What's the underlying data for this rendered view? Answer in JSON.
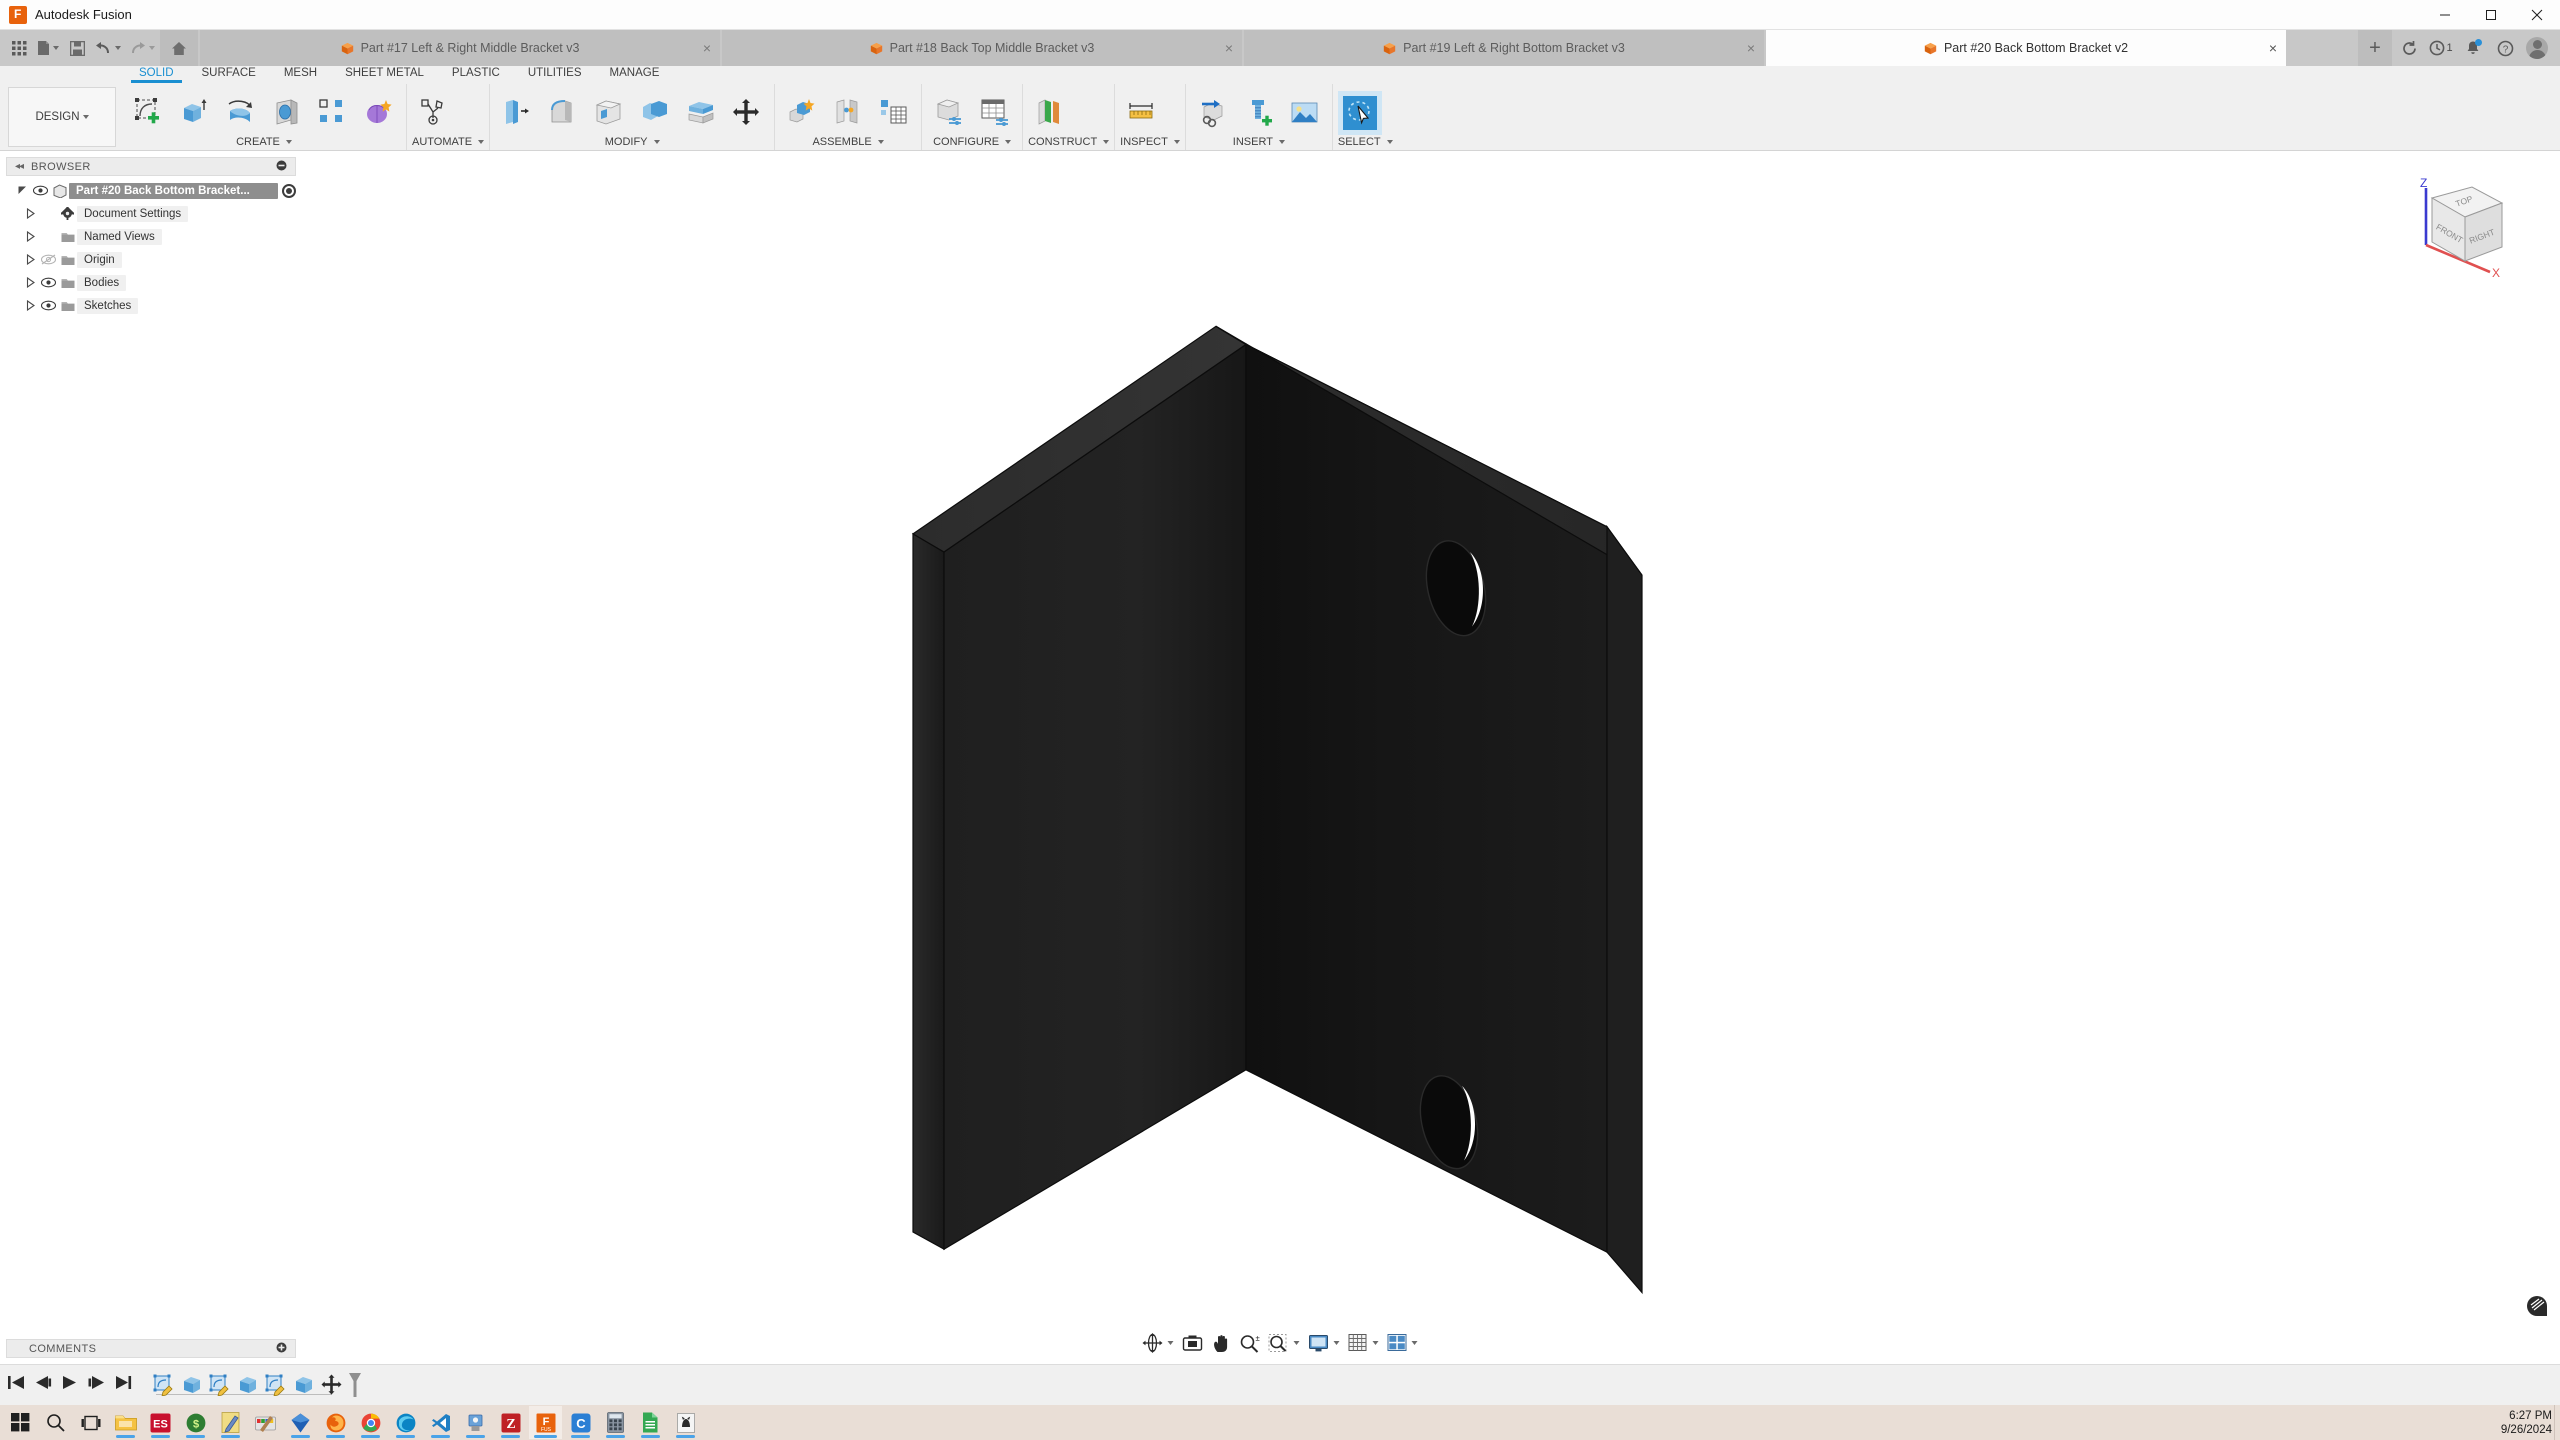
{
  "window": {
    "app_title": "Autodesk Fusion",
    "app_icon": "fusion-logo-icon",
    "minimize_label": "Minimize",
    "maximize_label": "Maximize",
    "close_label": "Close"
  },
  "quick_access": {
    "items": [
      {
        "name": "app-grid-icon",
        "label": "Show Data Panel"
      },
      {
        "name": "new-file-icon",
        "label": "File",
        "has_dropdown": true
      },
      {
        "name": "save-icon",
        "label": "Save"
      },
      {
        "name": "undo-icon",
        "label": "Undo",
        "has_dropdown": true
      },
      {
        "name": "redo-icon",
        "label": "Redo",
        "has_dropdown": true,
        "disabled": true
      },
      {
        "name": "home-icon",
        "label": "Home"
      }
    ]
  },
  "document_tabs": [
    {
      "label": "Part #17 Left & Right Middle Bracket v3",
      "active": false,
      "close": "×"
    },
    {
      "label": "Part #18 Back Top Middle Bracket v3",
      "active": false,
      "close": "×"
    },
    {
      "label": "Part #19 Left & Right Bottom Bracket v3",
      "active": false,
      "close": "×"
    },
    {
      "label": "Part #20 Back Bottom Bracket v2",
      "active": true,
      "close": "×"
    }
  ],
  "appbar_right": {
    "new_tab": "+",
    "items": [
      {
        "name": "refresh-icon",
        "label": "Refresh"
      },
      {
        "name": "job-status-icon",
        "label": "Job Status",
        "count": "1"
      },
      {
        "name": "notifications-bell-icon",
        "label": "Notifications",
        "badge": true
      },
      {
        "name": "help-icon",
        "label": "Help"
      },
      {
        "name": "account-avatar",
        "label": "Account"
      }
    ]
  },
  "ribbon": {
    "workspace_label": "DESIGN",
    "tabs": [
      {
        "label": "SOLID",
        "active": true
      },
      {
        "label": "SURFACE",
        "active": false
      },
      {
        "label": "MESH",
        "active": false
      },
      {
        "label": "SHEET METAL",
        "active": false
      },
      {
        "label": "PLASTIC",
        "active": false
      },
      {
        "label": "UTILITIES",
        "active": false
      },
      {
        "label": "MANAGE",
        "active": false
      }
    ],
    "panels": [
      {
        "label": "CREATE",
        "dropdown": true,
        "commands": [
          {
            "name": "create-sketch-icon",
            "label": "Create Sketch"
          },
          {
            "name": "extrude-icon",
            "label": "Extrude"
          },
          {
            "name": "revolve-icon",
            "label": "Revolve"
          },
          {
            "name": "sweep-icon",
            "label": "Sweep"
          },
          {
            "name": "pattern-icon",
            "label": "Pattern"
          },
          {
            "name": "form-icon",
            "label": "Create Form"
          }
        ]
      },
      {
        "label": "AUTOMATE",
        "dropdown": true,
        "commands": [
          {
            "name": "automate-generative-icon",
            "label": "Automate"
          }
        ]
      },
      {
        "label": "MODIFY",
        "dropdown": true,
        "commands": [
          {
            "name": "press-pull-icon",
            "label": "Press Pull"
          },
          {
            "name": "fillet-icon",
            "label": "Fillet"
          },
          {
            "name": "shell-icon",
            "label": "Shell"
          },
          {
            "name": "combine-icon",
            "label": "Combine"
          },
          {
            "name": "split-body-icon",
            "label": "Split Body"
          },
          {
            "name": "move-copy-icon",
            "label": "Move/Copy"
          }
        ]
      },
      {
        "label": "ASSEMBLE",
        "dropdown": true,
        "commands": [
          {
            "name": "new-component-icon",
            "label": "New Component"
          },
          {
            "name": "joint-icon",
            "label": "Joint"
          },
          {
            "name": "bill-of-materials-icon",
            "label": "Bill of Materials"
          }
        ]
      },
      {
        "label": "CONFIGURE",
        "dropdown": true,
        "commands": [
          {
            "name": "configuration-icon",
            "label": "Create Configuration"
          },
          {
            "name": "configuration-table-icon",
            "label": "Configuration Table"
          }
        ]
      },
      {
        "label": "CONSTRUCT",
        "dropdown": true,
        "commands": [
          {
            "name": "offset-plane-icon",
            "label": "Offset Plane"
          }
        ]
      },
      {
        "label": "INSPECT",
        "dropdown": true,
        "commands": [
          {
            "name": "measure-icon",
            "label": "Measure"
          }
        ]
      },
      {
        "label": "INSERT",
        "dropdown": true,
        "commands": [
          {
            "name": "insert-derive-icon",
            "label": "Derive"
          },
          {
            "name": "insert-mcmaster-icon",
            "label": "Insert McMaster-Carr Component"
          },
          {
            "name": "insert-canvas-icon",
            "label": "Canvas"
          }
        ]
      },
      {
        "label": "SELECT",
        "dropdown": true,
        "commands": [
          {
            "name": "select-icon",
            "label": "Select",
            "selected": true
          }
        ]
      }
    ]
  },
  "browser": {
    "header": "BROWSER",
    "collapse_icon": "collapse-left-icon",
    "options_icon": "panel-options-icon",
    "root": {
      "label": "Part #20 Back Bottom Bracket...",
      "icon": "component-icon",
      "visible": true,
      "selected": true,
      "activate_icon": "activate-component-icon"
    },
    "items": [
      {
        "label": "Document Settings",
        "icon": "gear-icon",
        "has_eye": false,
        "hidden": false
      },
      {
        "label": "Named Views",
        "icon": "folder-icon",
        "has_eye": false,
        "hidden": false
      },
      {
        "label": "Origin",
        "icon": "folder-icon",
        "has_eye": true,
        "hidden": true
      },
      {
        "label": "Bodies",
        "icon": "folder-icon",
        "has_eye": true,
        "hidden": false
      },
      {
        "label": "Sketches",
        "icon": "folder-icon",
        "has_eye": true,
        "hidden": false
      }
    ]
  },
  "comments": {
    "header": "COMMENTS",
    "add_icon": "add-comment-icon"
  },
  "viewcube": {
    "top_face": "TOP",
    "front_face": "FRONT",
    "right_face": "RIGHT",
    "axis_z": "Z",
    "axis_x": "X",
    "axis_z_color": "#3a3ad0",
    "axis_x_color": "#e05050"
  },
  "nav_toolbar": {
    "items": [
      {
        "name": "orbit-icon",
        "label": "Orbit",
        "has_dropdown": true
      },
      {
        "name": "look-at-icon",
        "label": "Look At",
        "has_dropdown": false
      },
      {
        "name": "pan-icon",
        "label": "Pan",
        "has_dropdown": false
      },
      {
        "name": "zoom-icon",
        "label": "Zoom",
        "has_dropdown": false
      },
      {
        "name": "fit-icon",
        "label": "Fit",
        "has_dropdown": true
      },
      {
        "name": "display-settings-icon",
        "label": "Display Settings",
        "has_dropdown": true
      },
      {
        "name": "grid-snaps-icon",
        "label": "Grid and Snaps",
        "has_dropdown": true
      },
      {
        "name": "viewports-icon",
        "label": "Viewports",
        "has_dropdown": true
      }
    ]
  },
  "viewport": {
    "background": "#ffffff",
    "model_name": "back-bottom-bracket-l-angle",
    "model_color": "#1c1c1c",
    "hole_count": 2,
    "marking_menu_icon": "marking-menu-icon",
    "settings_gear_icon": "view-settings-gear-icon"
  },
  "timeline": {
    "playback": [
      {
        "name": "timeline-go-to-beginning",
        "label": "Go to beginning"
      },
      {
        "name": "timeline-step-back",
        "label": "Step back"
      },
      {
        "name": "timeline-play",
        "label": "Play"
      },
      {
        "name": "timeline-step-forward",
        "label": "Step forward"
      },
      {
        "name": "timeline-go-to-end",
        "label": "Go to end"
      }
    ],
    "features": [
      {
        "name": "timeline-feature-sketch",
        "label": "Sketch1",
        "type": "sketch"
      },
      {
        "name": "timeline-feature-extrude",
        "label": "Extrude1",
        "type": "extrude"
      },
      {
        "name": "timeline-feature-sketch",
        "label": "Sketch2",
        "type": "sketch"
      },
      {
        "name": "timeline-feature-extrude",
        "label": "Extrude2",
        "type": "extrude"
      },
      {
        "name": "timeline-feature-sketch",
        "label": "Sketch3",
        "type": "sketch"
      },
      {
        "name": "timeline-feature-extrude",
        "label": "Extrude3",
        "type": "extrude"
      },
      {
        "name": "timeline-feature-move-copy",
        "label": "Move/Copy",
        "type": "move"
      }
    ],
    "marker": "timeline-end-marker"
  },
  "taskbar": {
    "items": [
      {
        "name": "start-button",
        "label": "Start",
        "running": false
      },
      {
        "name": "search-icon",
        "label": "Search",
        "running": false
      },
      {
        "name": "task-view-icon",
        "label": "Task View",
        "running": false
      },
      {
        "name": "file-explorer-icon",
        "label": "File Explorer",
        "running": true,
        "color": "#f5c243"
      },
      {
        "name": "eagle-cad-icon",
        "label": "ES",
        "running": true,
        "color": "#c8102e"
      },
      {
        "name": "app-green-icon",
        "label": "Green App",
        "running": true,
        "color": "#2e7d32"
      },
      {
        "name": "notepad-icon",
        "label": "Editor",
        "running": true,
        "color": "#e8c547"
      },
      {
        "name": "paint-icon",
        "label": "Paint",
        "running": false,
        "color": "#c84f4f"
      },
      {
        "name": "blue-diamond-icon",
        "label": "Blue App",
        "running": true,
        "color": "#1f5fb4"
      },
      {
        "name": "firefox-icon",
        "label": "Firefox",
        "running": true,
        "color": "#e8620c"
      },
      {
        "name": "chrome-icon",
        "label": "Google Chrome",
        "running": true,
        "color": "#4285f4"
      },
      {
        "name": "edge-icon",
        "label": "Microsoft Edge",
        "running": true,
        "color": "#0b84c4"
      },
      {
        "name": "vscode-icon",
        "label": "Visual Studio Code",
        "running": true,
        "color": "#1f7fc4"
      },
      {
        "name": "printer-3d-icon",
        "label": "3D Printer App",
        "running": true,
        "color": "#6aa2d8"
      },
      {
        "name": "filezilla-icon",
        "label": "FileZilla",
        "running": true,
        "color": "#bf2025"
      },
      {
        "name": "fusion-icon",
        "label": "Autodesk Fusion",
        "running": true,
        "active": true,
        "color": "#e8620c"
      },
      {
        "name": "cura-icon",
        "label": "C App",
        "running": true,
        "color": "#2b7fd4"
      },
      {
        "name": "calculator-icon",
        "label": "Calculator",
        "running": true,
        "color": "#6f7a86"
      },
      {
        "name": "sheets-icon",
        "label": "Spreadsheet",
        "running": true,
        "color": "#34a853"
      },
      {
        "name": "cat-app-icon",
        "label": "App",
        "running": true,
        "color": "#f0f0f0"
      }
    ],
    "clock_time": "6:27 PM",
    "clock_date": "9/26/2024"
  }
}
